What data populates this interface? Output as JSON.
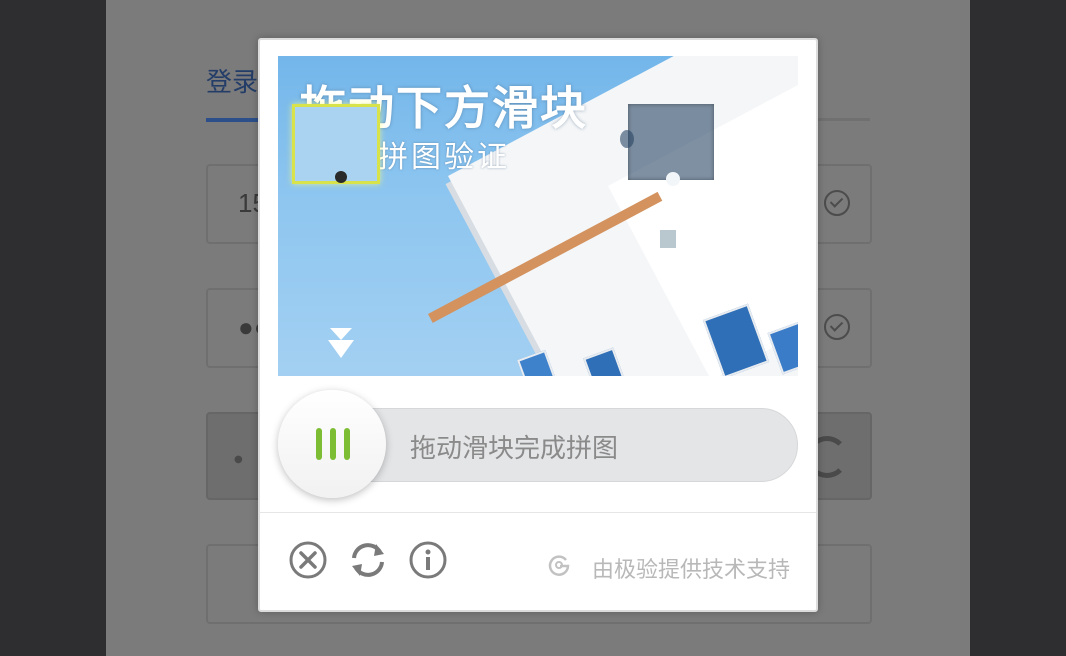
{
  "login": {
    "tab_label": "登录",
    "phone_value": "15",
    "password_dots": "●●",
    "captcha_dots": "● ●"
  },
  "captcha": {
    "image_title": "拖动下方滑块",
    "image_subtitle": "拼图验证",
    "slider_hint": "拖动滑块完成拼图",
    "brand_text": "由极验提供技术支持",
    "accent_color": "#7cbd34",
    "icons": [
      "close-icon",
      "refresh-icon",
      "info-icon",
      "geetest-logo-icon",
      "down-arrow-icon",
      "check-icon"
    ]
  }
}
